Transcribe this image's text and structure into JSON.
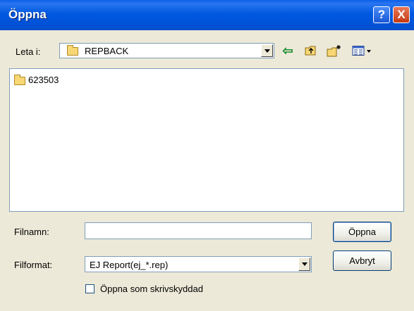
{
  "window": {
    "title": "Öppna",
    "help_glyph": "?",
    "close_glyph": "X"
  },
  "lookin": {
    "label": "Leta i:",
    "value": "REPBACK",
    "folder_icon": "folder-icon"
  },
  "toolbar": {
    "back_glyph": "⇦",
    "items": [
      "back-icon",
      "up-folder-icon",
      "new-folder-icon",
      "view-menu-icon"
    ]
  },
  "files": [
    {
      "name": "623503",
      "icon": "folder-icon"
    }
  ],
  "filename": {
    "label": "Filnamn:",
    "value": ""
  },
  "filetype": {
    "label": "Filformat:",
    "value": "EJ Report(ej_*.rep)"
  },
  "buttons": {
    "open": "Öppna",
    "cancel": "Avbryt"
  },
  "readonly": {
    "label": "Öppna som skrivskyddad",
    "checked": false
  },
  "colors": {
    "titlebar": "#0054E3",
    "face": "#ECE9D8",
    "border": "#7F9DB9"
  }
}
